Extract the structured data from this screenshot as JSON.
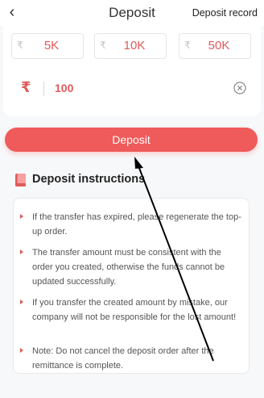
{
  "header": {
    "title": "Deposit",
    "record_link": "Deposit record",
    "back_icon": "back-chevron-icon"
  },
  "quick_amounts": [
    {
      "currency": "₹",
      "label": "5K"
    },
    {
      "currency": "₹",
      "label": "10K"
    },
    {
      "currency": "₹",
      "label": "50K"
    }
  ],
  "amount_input": {
    "currency": "₹",
    "value": "100",
    "clear_icon": "clear-circle-icon"
  },
  "deposit_button": {
    "label": "Deposit"
  },
  "instructions": {
    "title": "Deposit instructions",
    "icon": "book-icon",
    "items": [
      "If the transfer has expired, please regenerate the top-up order.",
      "The transfer amount must be consistent with the order you created, otherwise the funds cannot be updated successfully.",
      "If you transfer the created amount by mistake, our company will not be responsible for the lost amount!",
      "Note: Do not cancel the deposit order after the remittance is complete."
    ]
  },
  "colors": {
    "accent": "#ef5a5a",
    "accent_text": "#e05a5a",
    "background": "#f7f8fa"
  }
}
